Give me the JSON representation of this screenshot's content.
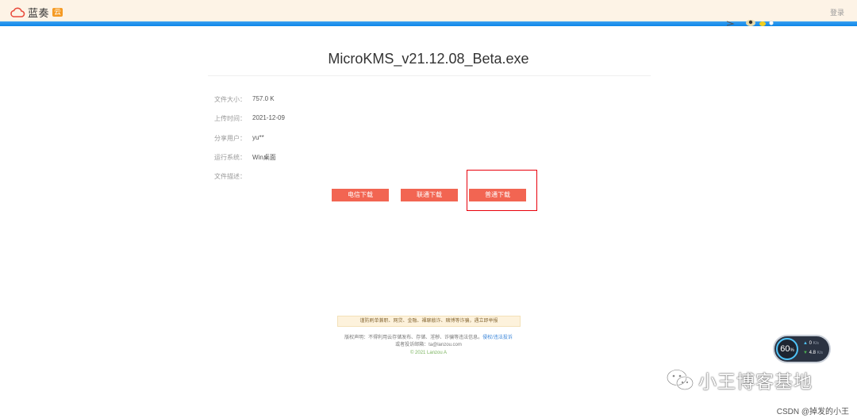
{
  "header": {
    "logo_text": "蓝奏",
    "logo_badge": "云",
    "login_label": "登录",
    "accent_color": "#1a8eea"
  },
  "file": {
    "title": "MicroKMS_v21.12.08_Beta.exe",
    "rows": [
      {
        "label": "文件大小：",
        "value": "757.0 K"
      },
      {
        "label": "上传时间：",
        "value": "2021-12-09"
      },
      {
        "label": "分享用户：",
        "value": "yu**"
      },
      {
        "label": "运行系统：",
        "value": "Win桌面"
      },
      {
        "label": "文件描述：",
        "value": ""
      }
    ]
  },
  "downloads": {
    "telecom_label": "电信下载",
    "unicom_label": "联通下载",
    "normal_label": "普通下载",
    "button_color": "#f26552"
  },
  "footer": {
    "notice": "谨防刷单兼职、网贷、金融、裸聊敲诈、赌博等诈骗，遇立即举报",
    "disclaimer": "版权声明：不得利用云存储发布、存储、淫秽、诈骗等违法信息。",
    "report_link": "侵权/违法投诉",
    "complaint": "或者投诉邮箱：ta@lanzou.com",
    "copyright": "© 2021 Lanzou A"
  },
  "speed_widget": {
    "percent": "60",
    "percent_unit": "%",
    "upload": "0",
    "upload_unit": "K/s",
    "download": "4.8",
    "download_unit": "K/s"
  },
  "watermark": {
    "text": "小王博客基地",
    "csdn": "CSDN @掉发的小王"
  }
}
